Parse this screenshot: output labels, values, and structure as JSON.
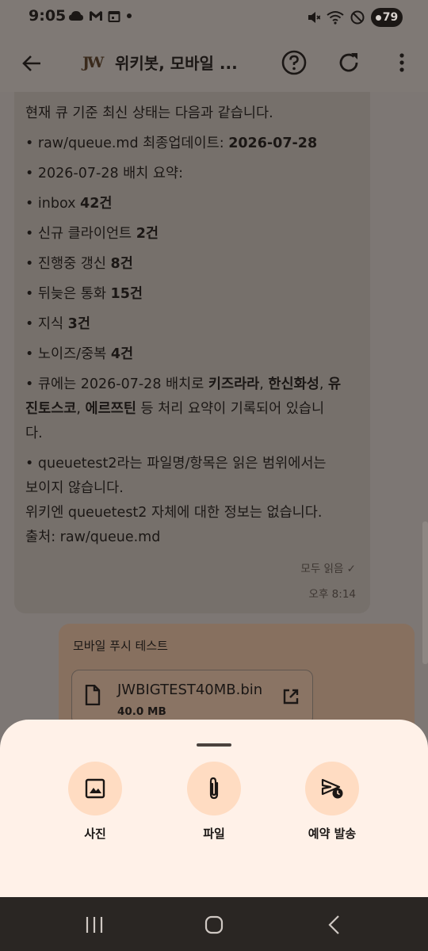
{
  "status_bar": {
    "time": "9:05",
    "left_icons": [
      "cloud-icon",
      "gmail-icon",
      "calendar-icon",
      "dot-icon"
    ],
    "right_icons": [
      "mute-icon",
      "wifi-icon",
      "dnd-icon"
    ],
    "battery": "79"
  },
  "app_bar": {
    "back_icon": "arrow-left-icon",
    "logo_text": "JW",
    "title": "위키봇, 모바일 ...",
    "help_icon": "help-circle-icon",
    "refresh_icon": "refresh-icon",
    "more_icon": "more-vertical-icon"
  },
  "messages": {
    "bot": {
      "intro": "현재 큐 기준 최신 상태는 다음과 같습니다.",
      "updated_prefix": "• raw/queue.md 최종업데이트: ",
      "updated_date": "2026-07-28",
      "batch_summary": "• 2026-07-28 배치 요약:",
      "items": [
        {
          "label": "• inbox ",
          "value": "42건"
        },
        {
          "label": "• 신규 클라이언트 ",
          "value": "2건"
        },
        {
          "label": "• 진행중 갱신 ",
          "value": "8건"
        },
        {
          "label": "• 뒤늦은 통화 ",
          "value": "15건"
        },
        {
          "label": "• 지식 ",
          "value": "3건"
        },
        {
          "label": "• 노이즈/중복 ",
          "value": "4건"
        }
      ],
      "queue_line1_prefix": "• 큐에는 2026-07-28 배치로 ",
      "company1": "키즈라라",
      "sep1": ", ",
      "company2": "한신화성",
      "sep2": ", ",
      "company3_a": "유",
      "company3_b": "진토스코",
      "sep3": ", ",
      "company4": "에르쯔틴",
      "queue_line2_suffix": " 등 처리 요약이 기록되어 있습니",
      "queue_line3": "다.",
      "queuetest_line1": "• queuetest2라는 파일명/항목은 읽은 범위에서는",
      "queuetest_line2": "보이지 않습니다.",
      "wiki_line": "위키엔 queuetest2 자체에 대한 정보는 없습니다.",
      "source_line": "출처: raw/queue.md",
      "read_status": "모두 읽음 ✓",
      "time": "오후 8:14"
    },
    "user": {
      "title": "모바일 푸시 테스트",
      "file_name": "JWBIGTEST40MB.bin",
      "file_size": "40.0 MB",
      "file_icon": "file-icon",
      "open_icon": "open-external-icon"
    }
  },
  "bottom_sheet": {
    "actions": [
      {
        "label": "사진",
        "icon": "image-icon"
      },
      {
        "label": "파일",
        "icon": "paperclip-icon"
      },
      {
        "label": "예약 발송",
        "icon": "schedule-send-icon"
      }
    ]
  },
  "nav_bar": {
    "recent_icon": "recent-apps-icon",
    "home_icon": "home-icon",
    "back_icon": "back-icon"
  }
}
